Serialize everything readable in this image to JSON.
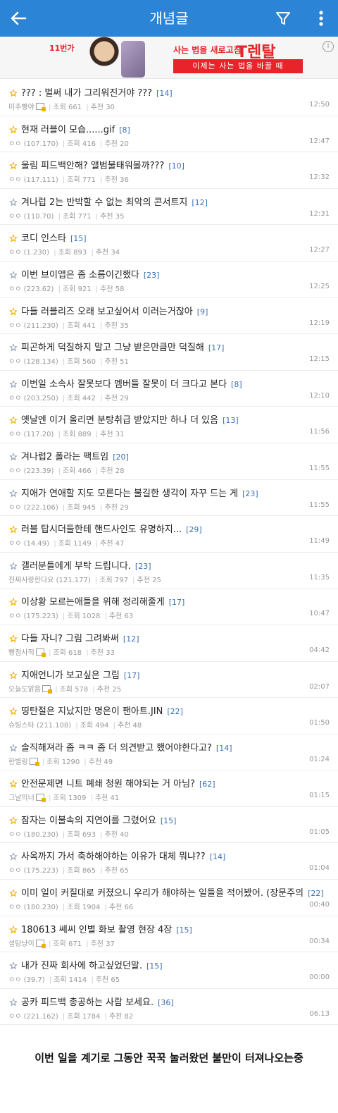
{
  "header": {
    "title": "개념글"
  },
  "ad": {
    "brand": "11번가",
    "slogan": "사는 법을 새로고침",
    "rental": "T렌탈",
    "sub": "이제는 사는 법을 바꿀 때",
    "info": "i"
  },
  "posts": [
    {
      "icon": "gold",
      "title": "??? : 벌써 내가 그리워진거야 ???",
      "comments": "[14]",
      "author": "미주빵야",
      "gall": true,
      "views": "조회 661",
      "recs": "추천 30",
      "time": "12:50"
    },
    {
      "icon": "gold",
      "title": "현재 러블이 모습......gif",
      "comments": "[8]",
      "author": "ㅇㅇ (107.170)",
      "gall": false,
      "views": "조회 416",
      "recs": "추천 20",
      "time": "12:47"
    },
    {
      "icon": "gold",
      "title": "울림 피드백안해? 앨범불태워볼까???",
      "comments": "[10]",
      "author": "ㅇㅇ (117.111)",
      "gall": false,
      "views": "조회 771",
      "recs": "추천 36",
      "time": "12:32"
    },
    {
      "icon": "silver",
      "title": "겨나럽 2는 반박할 수 없는 최악의 콘서트지",
      "comments": "[12]",
      "author": "ㅇㅇ (110.70)",
      "gall": false,
      "views": "조회 771",
      "recs": "추천 35",
      "time": "12:31"
    },
    {
      "icon": "gold",
      "title": "코디 인스타",
      "comments": "[15]",
      "author": "ㅇㅇ (1.230)",
      "gall": false,
      "views": "조회 893",
      "recs": "추천 34",
      "time": "12:27"
    },
    {
      "icon": "silver",
      "title": "이번 브이앱은 좀 소름이긴했다",
      "comments": "[23]",
      "author": "ㅇㅇ (223.62)",
      "gall": false,
      "views": "조회 921",
      "recs": "추천 58",
      "time": "12:25"
    },
    {
      "icon": "gold",
      "title": "다들 러블리즈 오래 보고싶어서 이러는거잖아",
      "comments": "[9]",
      "author": "ㅇㅇ (211.230)",
      "gall": false,
      "views": "조회 441",
      "recs": "추천 35",
      "time": "12:19"
    },
    {
      "icon": "silver",
      "title": "피곤하게 덕질하지 말고 그냥 받은만큼만 덕질해",
      "comments": "[17]",
      "author": "ㅇㅇ (128.134)",
      "gall": false,
      "views": "조회 560",
      "recs": "추천 51",
      "time": "12:15"
    },
    {
      "icon": "silver",
      "title": "이번일 소속사 잘못보다 멤버들 잘못이 더 크다고 본다",
      "comments": "[8]",
      "author": "ㅇㅇ (203.250)",
      "gall": false,
      "views": "조회 442",
      "recs": "추천 29",
      "time": "12:10"
    },
    {
      "icon": "gold",
      "title": "옛날엔 이거 올리면 분탕취급 받았지만 하나 더 있음",
      "comments": "[13]",
      "author": "ㅇㅇ (117.20)",
      "gall": false,
      "views": "조회 889",
      "recs": "추천 31",
      "time": "11:56"
    },
    {
      "icon": "silver",
      "title": "겨나럽2 폴라는 팩트임",
      "comments": "[20]",
      "author": "ㅇㅇ (223.39)",
      "gall": false,
      "views": "조회 466",
      "recs": "추천 28",
      "time": "11:55"
    },
    {
      "icon": "silver",
      "title": "지애가 연애할 지도 모른다는 불길한 생각이 자꾸 드는 게",
      "comments": "[23]",
      "author": "ㅇㅇ (222.106)",
      "gall": false,
      "views": "조회 945",
      "recs": "추천 29",
      "time": "11:55"
    },
    {
      "icon": "gold",
      "title": "러블 탑시더들한테 핸드사인도 유명하지...",
      "comments": "[29]",
      "author": "ㅇㅇ (14.49)",
      "gall": false,
      "views": "조회 1149",
      "recs": "추천 47",
      "time": "11:49"
    },
    {
      "icon": "silver",
      "title": "갤러분들에게 부탁 드립니다.",
      "comments": "[23]",
      "author": "진짜사랑한다요 (121.177)",
      "gall": false,
      "views": "조회 797",
      "recs": "추천 25",
      "time": "11:35"
    },
    {
      "icon": "gold",
      "title": "이상황 모르는애들을 위해 정리해줄게",
      "comments": "[17]",
      "author": "ㅇㅇ (175.223)",
      "gall": false,
      "views": "조회 1028",
      "recs": "추천 63",
      "time": "10:47"
    },
    {
      "icon": "gold",
      "title": "다들 자니? 그림 그려봐써",
      "comments": "[12]",
      "author": "빵점사적",
      "gall": true,
      "views": "조회 618",
      "recs": "추천 33",
      "time": "04:42"
    },
    {
      "icon": "gold",
      "title": "지애언니가 보고싶은 그림",
      "comments": "[17]",
      "author": "오늘도맑음",
      "gall": true,
      "views": "조회 578",
      "recs": "추천 25",
      "time": "02:07"
    },
    {
      "icon": "gold",
      "title": "띵탄절은 지났지만 명은이 팬아트.JIN",
      "comments": "[22]",
      "author": "슈팅스타 (211.108)",
      "gall": false,
      "views": "조회 494",
      "recs": "추천 48",
      "time": "01:50"
    },
    {
      "icon": "silver",
      "title": "솔직해져라 좀 ㅋㅋ 좀 더 의견받고 했어야한다고?",
      "comments": "[14]",
      "author": "한별링",
      "gall": true,
      "views": "조회 1290",
      "recs": "추천 49",
      "time": "01:24"
    },
    {
      "icon": "gold",
      "title": "안전문제면 니트 폐쇄 청원 해야되는 거 아님?",
      "comments": "[62]",
      "author": "그날의너",
      "gall": true,
      "views": "조회 1309",
      "recs": "추천 41",
      "time": "01:15"
    },
    {
      "icon": "gold",
      "title": "잠자는 이불속의 지연이를 그렸어요",
      "comments": "[15]",
      "author": "ㅇㅇ (180.230)",
      "gall": false,
      "views": "조회 693",
      "recs": "추천 40",
      "time": "01:05"
    },
    {
      "icon": "silver",
      "title": "사옥까지 가서 축하해야하는 이유가 대체 뭐냐??",
      "comments": "[14]",
      "author": "ㅇㅇ (175.223)",
      "gall": false,
      "views": "조회 865",
      "recs": "추천 65",
      "time": "01:04"
    },
    {
      "icon": "gold",
      "title": "이미 일이 커질대로 커졌으니 우리가 해야하는 일들을 적어봤어. (장문주의",
      "comments": "[22]",
      "author": "ㅇㅇ (180.230)",
      "gall": false,
      "views": "조회 1904",
      "recs": "추천 66",
      "time": "00:40"
    },
    {
      "icon": "gold",
      "title": "180613 쎄씨 인별 화보 촬영 현장 4장",
      "comments": "[15]",
      "author": "설탕냥이",
      "gall": true,
      "views": "조회 671",
      "recs": "추천 37",
      "time": "00:34"
    },
    {
      "icon": "silver",
      "title": "내가 진짜 회사에 하고싶었던말.",
      "comments": "[15]",
      "author": "ㅇㅇ (39.7)",
      "gall": false,
      "views": "조회 1414",
      "recs": "추천 65",
      "time": "00:00"
    },
    {
      "icon": "silver",
      "title": "공카 피드백 총공하는 사람 보세요.",
      "comments": "[36]",
      "author": "ㅇㅇ (221.162)",
      "gall": false,
      "views": "조회 1784",
      "recs": "추천 82",
      "time": "06.13"
    }
  ],
  "caption": "이번 일을 계기로 그동안 꾹꾹 눌러왔던 불만이 터져나오는중",
  "colors": {
    "header": "#2c84d6",
    "comment": "#3a6fb5",
    "gold": "#f2b705",
    "silver": "#9aa8bb",
    "ad_red": "#e8232a"
  }
}
